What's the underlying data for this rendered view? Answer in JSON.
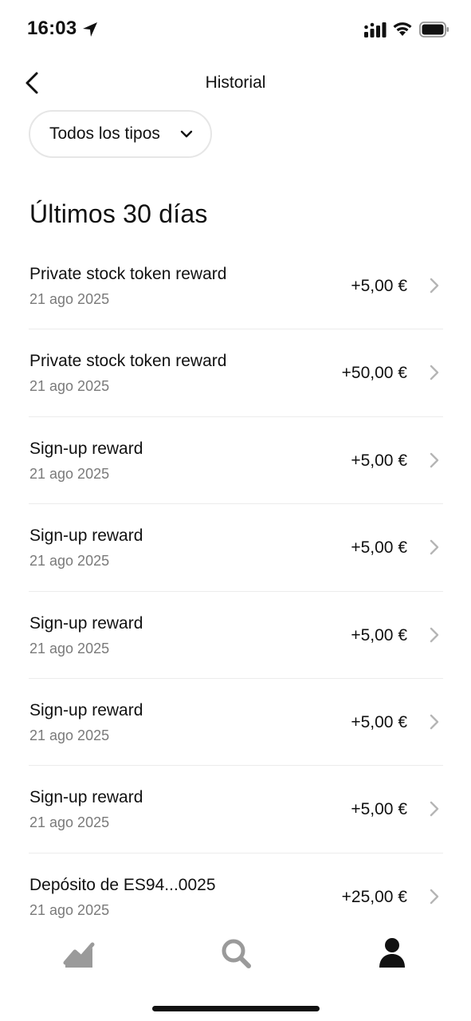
{
  "status_bar": {
    "time": "16:03",
    "icons": [
      "location-arrow-icon",
      "cellular-signal-icon",
      "wifi-icon",
      "battery-icon"
    ]
  },
  "nav": {
    "title": "Historial",
    "back_icon": "chevron-left-icon"
  },
  "filter": {
    "label": "Todos los tipos",
    "icon": "chevron-down-icon"
  },
  "section": {
    "title": "Últimos 30 días"
  },
  "transactions": [
    {
      "title": "Private stock token reward",
      "date": "21 ago 2025",
      "amount": "+5,00 €"
    },
    {
      "title": "Private stock token reward",
      "date": "21 ago 2025",
      "amount": "+50,00 €"
    },
    {
      "title": "Sign-up reward",
      "date": "21 ago 2025",
      "amount": "+5,00 €"
    },
    {
      "title": "Sign-up reward",
      "date": "21 ago 2025",
      "amount": "+5,00 €"
    },
    {
      "title": "Sign-up reward",
      "date": "21 ago 2025",
      "amount": "+5,00 €"
    },
    {
      "title": "Sign-up reward",
      "date": "21 ago 2025",
      "amount": "+5,00 €"
    },
    {
      "title": "Sign-up reward",
      "date": "21 ago 2025",
      "amount": "+5,00 €"
    },
    {
      "title": "Depósito de ES94...0025",
      "date": "21 ago 2025",
      "amount": "+25,00 €"
    }
  ],
  "tab_bar": {
    "tabs": [
      {
        "icon": "portfolio-chart-icon",
        "active": false
      },
      {
        "icon": "search-icon",
        "active": false
      },
      {
        "icon": "profile-icon",
        "active": true
      }
    ],
    "colors": {
      "active": "#111111",
      "inactive": "#9a9a9a"
    }
  }
}
